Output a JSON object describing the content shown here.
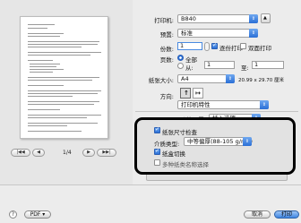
{
  "printer": {
    "label": "打印机:",
    "value": "B840"
  },
  "preset": {
    "label": "预置:",
    "value": "标准"
  },
  "copies": {
    "label": "份数:",
    "value": "1",
    "collate_label": "逐份打印",
    "collate_checked": true,
    "duplex_label": "双面打印",
    "duplex_checked": false
  },
  "pages": {
    "label": "页数:",
    "all_label": "全部",
    "from_label": "从:",
    "from_value": "1",
    "to_label": "至:",
    "to_value": "1"
  },
  "paper_size": {
    "label": "纸张大小:",
    "value": "A4",
    "dimensions": "20.99 x 29.70 厘米"
  },
  "orientation": {
    "label": "方向:"
  },
  "printer_features": {
    "value": "打印机特性"
  },
  "feature_set": {
    "label": "功能设置:",
    "value": "插入选项"
  },
  "options": {
    "paper_check_label": "纸张尺寸检查",
    "paper_check_checked": true,
    "media_type_label": "介质类型:",
    "media_type_value": "中等偏厚(88-105 g/m2)",
    "tray_label": "纸盒切换",
    "tray_checked": true,
    "paper_settings_label": "多种纸类名称选择",
    "paper_settings_checked": false
  },
  "preview": {
    "page_count": "1/4",
    "first": "|◀◀",
    "prev": "◀",
    "next": "▶",
    "last": "▶▶|"
  },
  "bottom": {
    "help": "?",
    "pdf_label": "PDF ▾",
    "cancel_label": "取消",
    "print_label": "打印"
  }
}
